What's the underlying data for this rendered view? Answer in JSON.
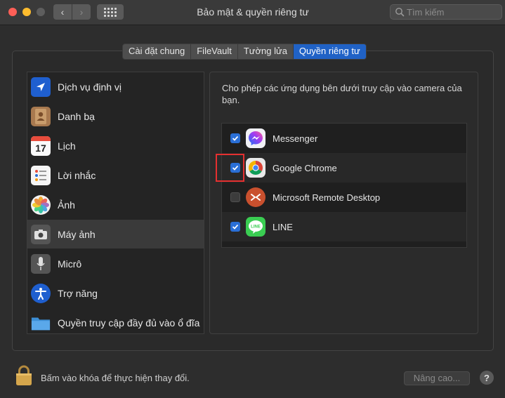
{
  "window": {
    "title": "Bảo mật & quyền riêng tư"
  },
  "search": {
    "placeholder": "Tìm kiếm"
  },
  "tabs": [
    {
      "label": "Cài đặt chung",
      "active": false
    },
    {
      "label": "FileVault",
      "active": false
    },
    {
      "label": "Tường lửa",
      "active": false
    },
    {
      "label": "Quyền riêng tư",
      "active": true
    }
  ],
  "sidebar": {
    "items": [
      {
        "label": "Dịch vụ định vị",
        "icon": "location-arrow-icon"
      },
      {
        "label": "Danh bạ",
        "icon": "contacts-book-icon"
      },
      {
        "label": "Lịch",
        "icon": "calendar-icon",
        "day": "17"
      },
      {
        "label": "Lời nhắc",
        "icon": "reminders-icon"
      },
      {
        "label": "Ảnh",
        "icon": "photos-icon"
      },
      {
        "label": "Máy ảnh",
        "icon": "camera-icon",
        "selected": true
      },
      {
        "label": "Micrô",
        "icon": "microphone-icon"
      },
      {
        "label": "Trợ năng",
        "icon": "accessibility-icon"
      },
      {
        "label": "Quyền truy cập đầy đủ vào ổ đĩa",
        "icon": "folder-icon"
      }
    ]
  },
  "main": {
    "description": "Cho phép các ứng dụng bên dưới truy cập vào camera của bạn.",
    "apps": [
      {
        "label": "Messenger",
        "checked": true,
        "icon": "messenger-icon"
      },
      {
        "label": "Google Chrome",
        "checked": true,
        "icon": "chrome-icon"
      },
      {
        "label": "Microsoft Remote Desktop",
        "checked": false,
        "icon": "remote-desktop-icon"
      },
      {
        "label": "LINE",
        "checked": true,
        "icon": "line-icon"
      }
    ]
  },
  "footer": {
    "lock_label": "Bấm vào khóa để thực hiện thay đổi.",
    "advanced_label": "Nâng cao...",
    "help_label": "?"
  },
  "colors": {
    "accent": "#2062c6",
    "highlight": "#e53030",
    "background": "#2d2d2d"
  }
}
